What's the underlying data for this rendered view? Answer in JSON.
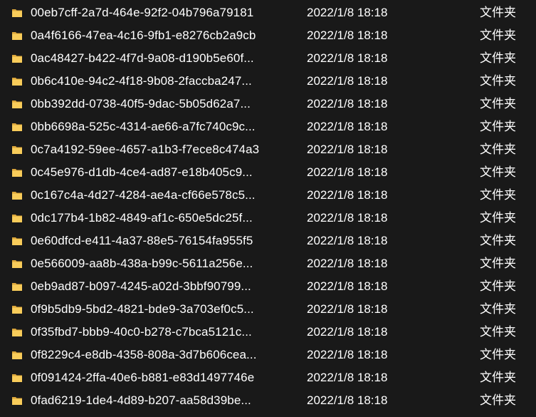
{
  "file_list": {
    "rows": [
      {
        "name": "00eb7cff-2a7d-464e-92f2-04b796a79181",
        "date": "2022/1/8 18:18",
        "type": "文件夹",
        "icon": "folder-icon"
      },
      {
        "name": "0a4f6166-47ea-4c16-9fb1-e8276cb2a9cb",
        "date": "2022/1/8 18:18",
        "type": "文件夹",
        "icon": "folder-icon"
      },
      {
        "name": "0ac48427-b422-4f7d-9a08-d190b5e60f...",
        "date": "2022/1/8 18:18",
        "type": "文件夹",
        "icon": "folder-icon"
      },
      {
        "name": "0b6c410e-94c2-4f18-9b08-2faccba247...",
        "date": "2022/1/8 18:18",
        "type": "文件夹",
        "icon": "folder-icon"
      },
      {
        "name": "0bb392dd-0738-40f5-9dac-5b05d62a7...",
        "date": "2022/1/8 18:18",
        "type": "文件夹",
        "icon": "folder-icon"
      },
      {
        "name": "0bb6698a-525c-4314-ae66-a7fc740c9c...",
        "date": "2022/1/8 18:18",
        "type": "文件夹",
        "icon": "folder-icon"
      },
      {
        "name": "0c7a4192-59ee-4657-a1b3-f7ece8c474a3",
        "date": "2022/1/8 18:18",
        "type": "文件夹",
        "icon": "folder-icon"
      },
      {
        "name": "0c45e976-d1db-4ce4-ad87-e18b405c9...",
        "date": "2022/1/8 18:18",
        "type": "文件夹",
        "icon": "folder-icon"
      },
      {
        "name": "0c167c4a-4d27-4284-ae4a-cf66e578c5...",
        "date": "2022/1/8 18:18",
        "type": "文件夹",
        "icon": "folder-icon"
      },
      {
        "name": "0dc177b4-1b82-4849-af1c-650e5dc25f...",
        "date": "2022/1/8 18:18",
        "type": "文件夹",
        "icon": "folder-icon"
      },
      {
        "name": "0e60dfcd-e411-4a37-88e5-76154fa955f5",
        "date": "2022/1/8 18:18",
        "type": "文件夹",
        "icon": "folder-icon"
      },
      {
        "name": "0e566009-aa8b-438a-b99c-5611a256e...",
        "date": "2022/1/8 18:18",
        "type": "文件夹",
        "icon": "folder-icon"
      },
      {
        "name": "0eb9ad87-b097-4245-a02d-3bbf90799...",
        "date": "2022/1/8 18:18",
        "type": "文件夹",
        "icon": "folder-icon"
      },
      {
        "name": "0f9b5db9-5bd2-4821-bde9-3a703ef0c5...",
        "date": "2022/1/8 18:18",
        "type": "文件夹",
        "icon": "folder-icon"
      },
      {
        "name": "0f35fbd7-bbb9-40c0-b278-c7bca5121c...",
        "date": "2022/1/8 18:18",
        "type": "文件夹",
        "icon": "folder-icon"
      },
      {
        "name": "0f8229c4-e8db-4358-808a-3d7b606cea...",
        "date": "2022/1/8 18:18",
        "type": "文件夹",
        "icon": "folder-icon"
      },
      {
        "name": "0f091424-2ffa-40e6-b881-e83d1497746e",
        "date": "2022/1/8 18:18",
        "type": "文件夹",
        "icon": "folder-icon"
      },
      {
        "name": "0fad6219-1de4-4d89-b207-aa58d39be...",
        "date": "2022/1/8 18:18",
        "type": "文件夹",
        "icon": "folder-icon"
      }
    ]
  },
  "colors": {
    "background": "#191919",
    "text": "#ffffff",
    "folder_front": "#f8cc5a",
    "folder_back": "#dca63a"
  }
}
